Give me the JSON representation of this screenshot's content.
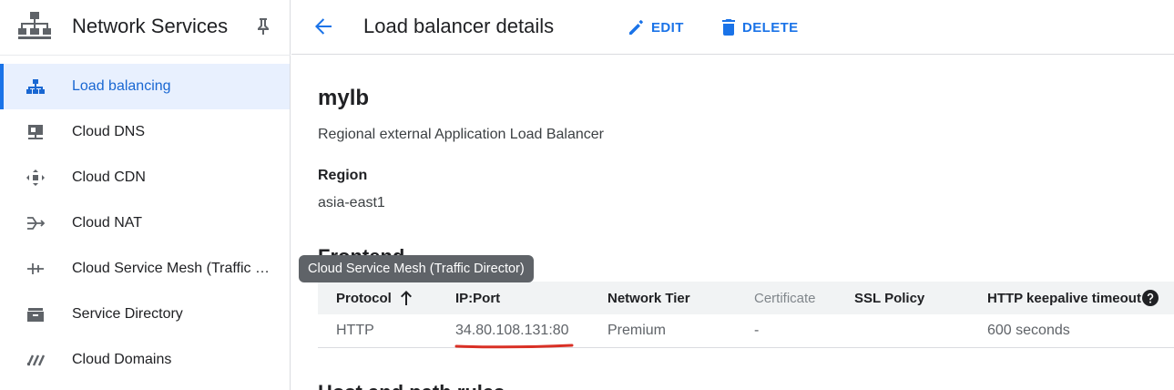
{
  "sidebar": {
    "product_title": "Network Services",
    "product_icon": "network-services-icon",
    "pin_icon": "pin-icon",
    "items": [
      {
        "label": "Load balancing",
        "icon": "load-balancing-icon",
        "active": true
      },
      {
        "label": "Cloud DNS",
        "icon": "cloud-dns-icon",
        "active": false
      },
      {
        "label": "Cloud CDN",
        "icon": "cloud-cdn-icon",
        "active": false
      },
      {
        "label": "Cloud NAT",
        "icon": "cloud-nat-icon",
        "active": false
      },
      {
        "label": "Cloud Service Mesh (Traffic …",
        "icon": "service-mesh-icon",
        "active": false
      },
      {
        "label": "Service Directory",
        "icon": "service-directory-icon",
        "active": false
      },
      {
        "label": "Cloud Domains",
        "icon": "cloud-domains-icon",
        "active": false
      }
    ]
  },
  "topbar": {
    "back_icon": "arrow-back-icon",
    "title": "Load balancer details",
    "edit_label": "EDIT",
    "delete_label": "DELETE"
  },
  "details": {
    "name": "mylb",
    "type": "Regional external Application Load Balancer",
    "region_label": "Region",
    "region_value": "asia-east1"
  },
  "frontend": {
    "title": "Frontend",
    "columns": [
      "Protocol",
      "IP:Port",
      "Network Tier",
      "Certificate",
      "SSL Policy",
      "HTTP keepalive timeout"
    ],
    "rows": [
      {
        "protocol": "HTTP",
        "ip_port": "34.80.108.131:80",
        "network_tier": "Premium",
        "certificate": "-",
        "ssl_policy": "",
        "keepalive": "600 seconds"
      }
    ]
  },
  "host_rules": {
    "title": "Host and path rules"
  },
  "tooltip": {
    "text": "Cloud Service Mesh (Traffic Director)"
  },
  "colors": {
    "accent": "#1a73e8",
    "active_bg": "#e8f0fe",
    "annotation_red": "#d93025"
  }
}
